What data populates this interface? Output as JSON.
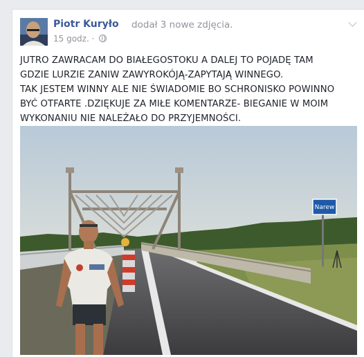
{
  "post": {
    "author": "Piotr Kuryło",
    "action": "dodał 3 nowe zdjęcia.",
    "time": "15 godz.",
    "separator": "·",
    "lines": [
      "JUTRO ZAWRACAM DO BIAŁEGOSTOKU A DALEJ TO POJADĘ TAM",
      "GDZIE LURZIE ZANIW ZAWYROKÓJĄ-ZAPYTAJĄ WINNEGO.",
      "TAK JESTEM WINNY ALE NIE ŚWIADOMIE BO SCHRONISKO POWINNO",
      "BYĆ OTFARTE .DZIĘKUJE ZA MIŁE KOMENTARZE- BIEGANIE W MOIM",
      "WYKONANIU NIE NALEŻAŁO DO PRZYJEMNOŚCI."
    ]
  },
  "photo": {
    "sign_text": "Narew"
  },
  "colors": {
    "link": "#3b5998",
    "meta": "#90949c",
    "text": "#1d2129"
  },
  "icons": {
    "privacy": "globe-icon",
    "menu": "chevron-down-icon"
  }
}
